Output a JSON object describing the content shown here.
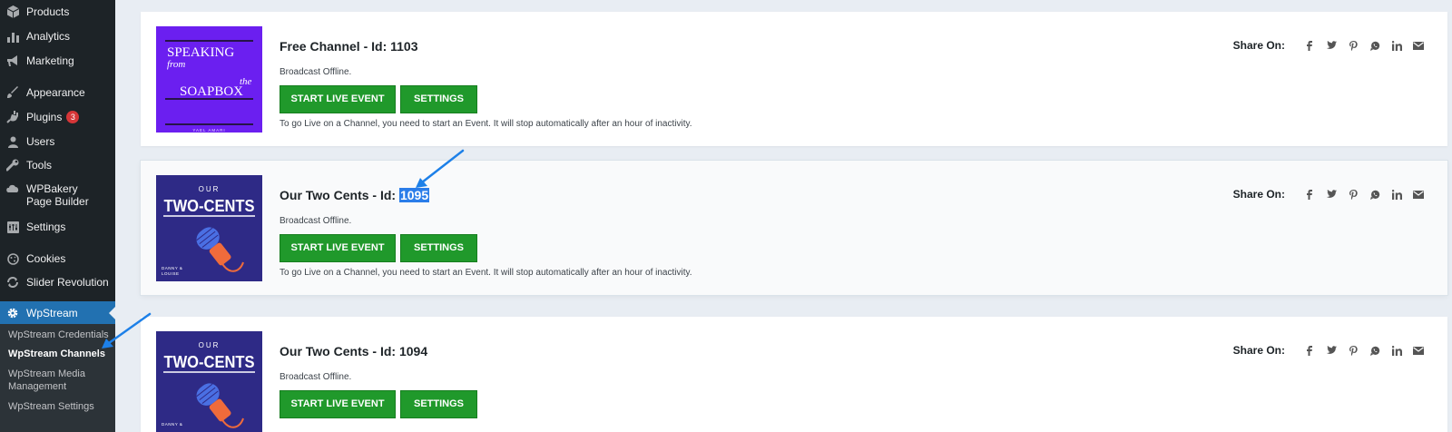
{
  "sidebar": {
    "items": [
      {
        "label": "Products",
        "icon": "products-icon"
      },
      {
        "label": "Analytics",
        "icon": "analytics-icon"
      },
      {
        "label": "Marketing",
        "icon": "marketing-icon"
      },
      {
        "label": "Appearance",
        "icon": "appearance-icon"
      },
      {
        "label": "Plugins",
        "icon": "plugins-icon",
        "badge": "3"
      },
      {
        "label": "Users",
        "icon": "users-icon"
      },
      {
        "label": "Tools",
        "icon": "tools-icon"
      },
      {
        "label": "WPBakery Page Builder",
        "icon": "wpbakery-icon"
      },
      {
        "label": "Settings",
        "icon": "settings-icon"
      },
      {
        "label": "Cookies",
        "icon": "cookies-icon"
      },
      {
        "label": "Slider Revolution",
        "icon": "slider-revolution-icon"
      },
      {
        "label": "WpStream",
        "icon": "wpstream-gear-icon"
      }
    ],
    "submenu": [
      {
        "label": "WpStream Credentials"
      },
      {
        "label": "WpStream Channels"
      },
      {
        "label": "WpStream Media Management"
      },
      {
        "label": "WpStream Settings"
      }
    ]
  },
  "channels": [
    {
      "title_prefix": "Free Channel - Id: ",
      "id": "1103",
      "status": "Broadcast Offline.",
      "live_button": "START LIVE EVENT",
      "settings_button": "SETTINGS",
      "note": "To go Live on a Channel, you need to start an Event. It will stop automatically after an hour of inactivity.",
      "thumb": {
        "line1": "SPEAKING",
        "line2": "from",
        "line3": "the",
        "line4": "SOAPBOX",
        "byline": "YAEL AMARI"
      }
    },
    {
      "title_prefix": "Our Two Cents - Id: ",
      "id": "1095",
      "status": "Broadcast Offline.",
      "live_button": "START LIVE EVENT",
      "settings_button": "SETTINGS",
      "note": "To go Live on a Channel, you need to start an Event. It will stop automatically after an hour of inactivity.",
      "thumb": {
        "line1": "OUR",
        "line2": "TWO-CENTS",
        "byline1": "DANNY &",
        "byline2": "LOUISE"
      }
    },
    {
      "title_prefix": "Our Two Cents - Id: ",
      "id": "1094",
      "status": "Broadcast Offline.",
      "live_button": "START LIVE EVENT",
      "settings_button": "SETTINGS",
      "thumb": {
        "line1": "OUR",
        "line2": "TWO-CENTS",
        "byline1": "DANNY &"
      }
    }
  ],
  "share": {
    "label": "Share On:",
    "icons": [
      "facebook-icon",
      "twitter-icon",
      "pinterest-icon",
      "whatsapp-icon",
      "linkedin-icon",
      "email-icon"
    ]
  },
  "colors": {
    "sidebar_bg": "#1d2327",
    "submenu_bg": "#2c3338",
    "active_menu": "#2271b1",
    "button_green": "#20992b",
    "badge_red": "#d63638",
    "annotation_blue": "#1d80e8",
    "page_bg": "#e8edf3"
  }
}
